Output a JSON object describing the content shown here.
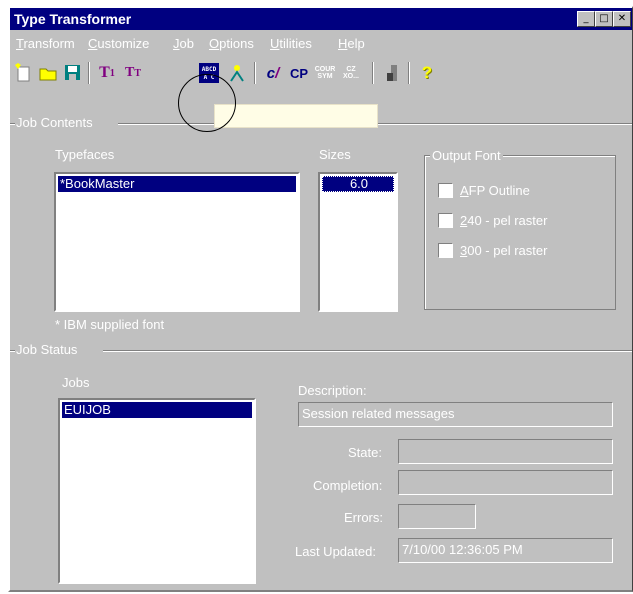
{
  "window": {
    "title": "Type Transformer"
  },
  "menu": [
    {
      "label_u": "T",
      "label_rest": "ransform"
    },
    {
      "label_u": "C",
      "label_rest": "ustomize"
    },
    {
      "label_u": "J",
      "label_rest": "ob"
    },
    {
      "label_u": "O",
      "label_rest": "ptions"
    },
    {
      "label_u": "U",
      "label_rest": "tilities"
    },
    {
      "label_u": "H",
      "label_rest": "elp"
    }
  ],
  "toolbar": {
    "icons": [
      "new-icon",
      "open-folder-icon",
      "save-icon",
      "type1-icon",
      "truetype-icon",
      "abcd-transform-icon",
      "run-job-icon",
      "c-icon",
      "cp-icon",
      "cour-sym-icon",
      "cz-xo-icon",
      "tool-icon",
      "help-icon"
    ]
  },
  "job_contents": {
    "group_label": "Job Contents",
    "typefaces_label": "Typefaces",
    "typefaces": [
      "*BookMaster"
    ],
    "sizes_label": "Sizes",
    "sizes": [
      "6.0"
    ],
    "footnote": "* IBM supplied font",
    "output_font": {
      "group_label": "Output Font",
      "options": [
        {
          "u": "A",
          "rest": "FP Outline",
          "checked": false
        },
        {
          "u": "2",
          "rest": "40 - pel raster",
          "checked": false
        },
        {
          "u": "3",
          "rest": "00 - pel raster",
          "checked": false
        }
      ]
    }
  },
  "job_status": {
    "group_label": "Job Status",
    "jobs_label": "Jobs",
    "jobs": [
      "EUIJOB"
    ],
    "description_label": "Description:",
    "description_value": "Session related messages",
    "state_label": "State:",
    "state_value": "",
    "completion_label": "Completion:",
    "completion_value": "",
    "errors_label": "Errors:",
    "errors_value": "",
    "last_updated_label": "Last Updated:",
    "last_updated_value": "7/10/00 12:36:05 PM"
  }
}
